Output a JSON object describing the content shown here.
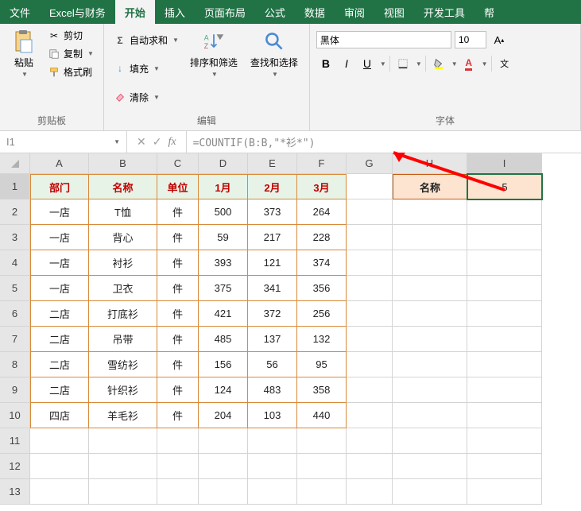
{
  "menu": {
    "file": "文件",
    "custom": "Excel与财务",
    "home": "开始",
    "insert": "插入",
    "layout": "页面布局",
    "formulas": "公式",
    "data": "数据",
    "review": "审阅",
    "view": "视图",
    "dev": "开发工具",
    "help": "帮"
  },
  "ribbon": {
    "clipboard": {
      "label": "剪贴板",
      "paste": "粘贴",
      "cut": "剪切",
      "copy": "复制",
      "painter": "格式刷"
    },
    "autosum": "自动求和",
    "fill": "填充",
    "clear": "清除",
    "sort": "排序和筛选",
    "find": "查找和选择",
    "edit_label": "编辑",
    "font": {
      "label": "字体",
      "name": "黑体",
      "size": "10"
    }
  },
  "namebox": "I1",
  "formula": "=COUNTIF(B:B,\"*衫*\")",
  "cols": [
    "A",
    "B",
    "C",
    "D",
    "E",
    "F",
    "G",
    "H",
    "I"
  ],
  "headers": {
    "a": "部门",
    "b": "名称",
    "c": "单位",
    "d": "1月",
    "e": "2月",
    "f": "3月"
  },
  "h_col": {
    "label": "名称",
    "value": "5"
  },
  "rows": [
    {
      "a": "一店",
      "b": "T恤",
      "c": "件",
      "d": "500",
      "e": "373",
      "f": "264"
    },
    {
      "a": "一店",
      "b": "背心",
      "c": "件",
      "d": "59",
      "e": "217",
      "f": "228"
    },
    {
      "a": "一店",
      "b": "衬衫",
      "c": "件",
      "d": "393",
      "e": "121",
      "f": "374"
    },
    {
      "a": "一店",
      "b": "卫衣",
      "c": "件",
      "d": "375",
      "e": "341",
      "f": "356"
    },
    {
      "a": "二店",
      "b": "打底衫",
      "c": "件",
      "d": "421",
      "e": "372",
      "f": "256"
    },
    {
      "a": "二店",
      "b": "吊带",
      "c": "件",
      "d": "485",
      "e": "137",
      "f": "132"
    },
    {
      "a": "二店",
      "b": "雪纺衫",
      "c": "件",
      "d": "156",
      "e": "56",
      "f": "95"
    },
    {
      "a": "二店",
      "b": "针织衫",
      "c": "件",
      "d": "124",
      "e": "483",
      "f": "358"
    },
    {
      "a": "四店",
      "b": "羊毛衫",
      "c": "件",
      "d": "204",
      "e": "103",
      "f": "440"
    }
  ]
}
